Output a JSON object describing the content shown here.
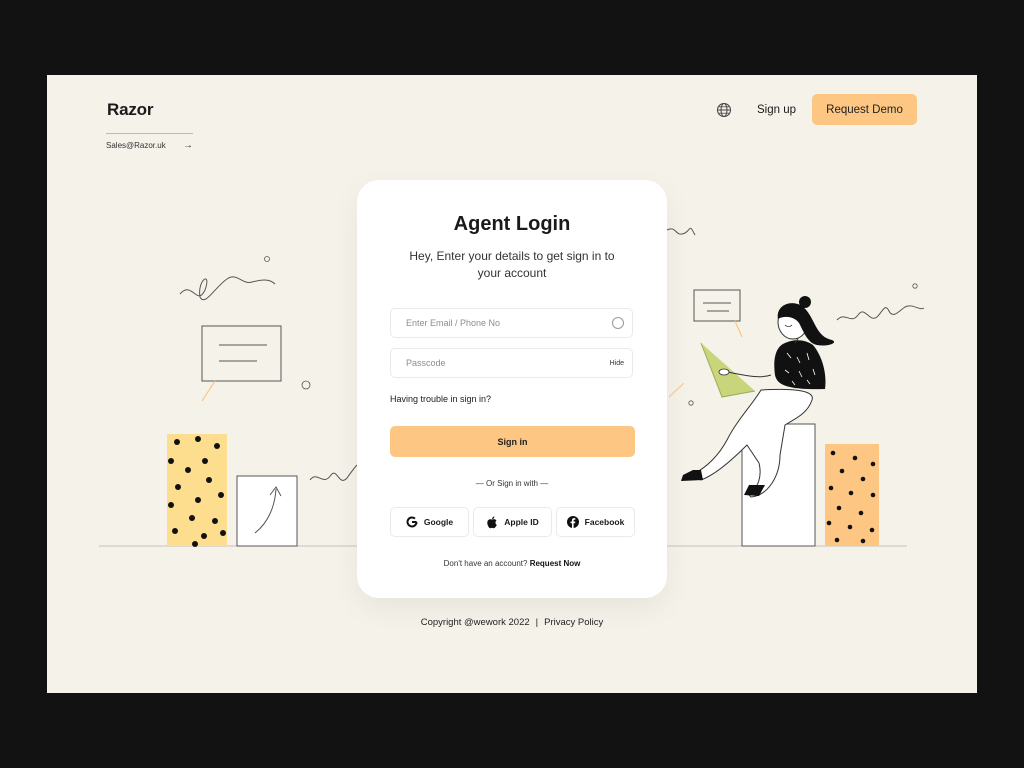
{
  "brand": {
    "name": "Razor",
    "email": "Sales@Razor.uk",
    "arrow": "→"
  },
  "nav": {
    "signup_label": "Sign up",
    "demo_label": "Request Demo"
  },
  "login": {
    "title": "Agent Login",
    "subtitle": "Hey, Enter your details to get sign in to your account",
    "email_placeholder": "Enter Email / Phone No",
    "passcode_placeholder": "Passcode",
    "hide_label": "Hide",
    "trouble_label": "Having trouble in sign in?",
    "signin_label": "Sign in",
    "or_label": "— Or Sign in with —",
    "providers": [
      "Google",
      "Apple ID",
      "Facebook"
    ],
    "no_account_text": "Don't have an account?",
    "request_now_label": "Request Now"
  },
  "footer": {
    "copyright": "Copyright @wework 2022",
    "separator": "|",
    "privacy_label": "Privacy Policy"
  },
  "colors": {
    "accent": "#fdc783",
    "background": "#f5f2ea",
    "yellow_block": "#fdde8e",
    "orange_block": "#fdc783",
    "laptop": "#c9d57a"
  }
}
